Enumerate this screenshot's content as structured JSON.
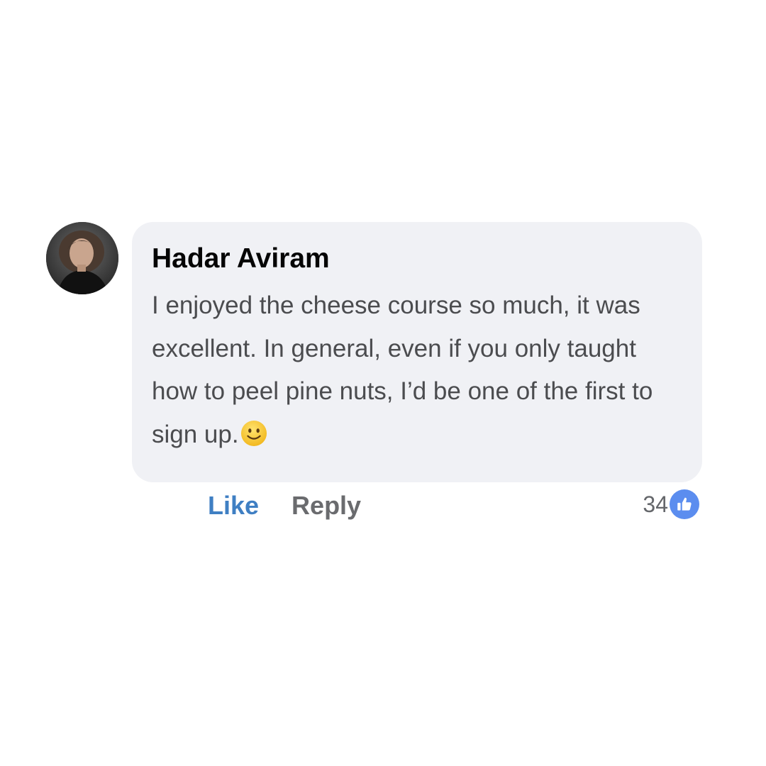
{
  "comment": {
    "author": "Hadar Aviram",
    "text": "I enjoyed the cheese course so much, it was excellent. In general, even if you only taught how to peel pine nuts, I’d be one of the first to sign up.",
    "emoji_icon": "slightly-smiling-face-icon"
  },
  "actions": {
    "like_label": "Like",
    "reply_label": "Reply"
  },
  "reactions": {
    "count": "34",
    "icon": "thumbs-up-icon"
  },
  "colors": {
    "bubble_bg": "#f0f1f5",
    "like_link": "#3f7fc3",
    "reaction_badge": "#5b8def",
    "text": "#4b4c4f"
  }
}
